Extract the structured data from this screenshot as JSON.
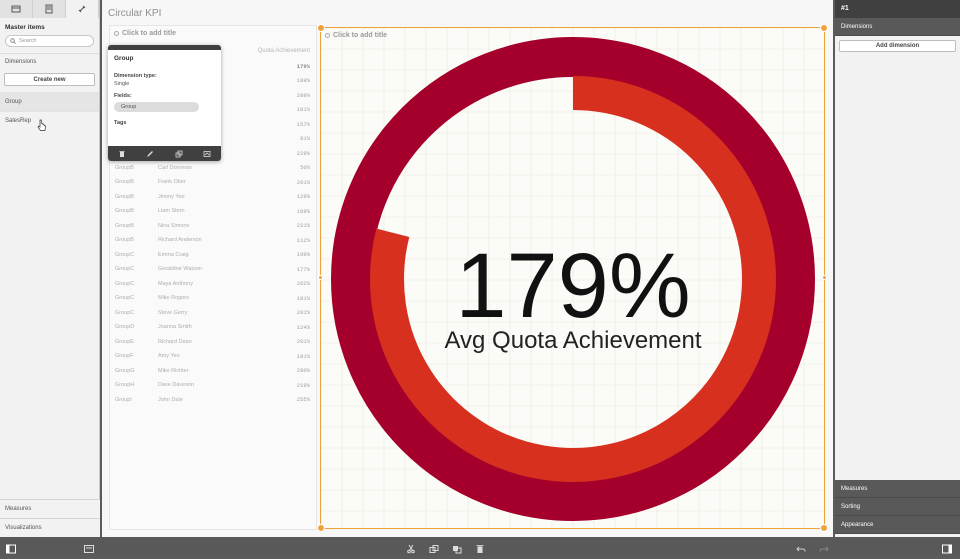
{
  "left_panel": {
    "title": "Master items",
    "search_placeholder": "Search",
    "dimensions_label": "Dimensions",
    "create_new_label": "Create new",
    "items": [
      {
        "label": "Group"
      },
      {
        "label": "SalesRep"
      }
    ],
    "measures_label": "Measures",
    "visualizations_label": "Visualizations"
  },
  "sheet": {
    "title": "Circular KPI"
  },
  "table": {
    "title": "Click to add title",
    "header_measure": "Quota Achievement",
    "total": "179%",
    "rows": [
      {
        "group": "",
        "rep": "",
        "value": "189%"
      },
      {
        "group": "",
        "rep": "",
        "value": "289%"
      },
      {
        "group": "",
        "rep": "",
        "value": "101%"
      },
      {
        "group": "",
        "rep": "",
        "value": "157%"
      },
      {
        "group": "",
        "rep": "",
        "value": "81%"
      },
      {
        "group": "",
        "rep": "",
        "value": "229%"
      },
      {
        "group": "GroupB",
        "rep": "Carl Donovan",
        "value": "50%"
      },
      {
        "group": "GroupB",
        "rep": "Frank Ober",
        "value": "261%"
      },
      {
        "group": "GroupB",
        "rep": "Jimmy Yeo",
        "value": "129%"
      },
      {
        "group": "GroupB",
        "rep": "Liam Stern",
        "value": "189%"
      },
      {
        "group": "GroupB",
        "rep": "Nina Simone",
        "value": "221%"
      },
      {
        "group": "GroupB",
        "rep": "Richard Anderson",
        "value": "112%"
      },
      {
        "group": "GroupC",
        "rep": "Emma Craig",
        "value": "199%"
      },
      {
        "group": "GroupC",
        "rep": "Geraldine Watson",
        "value": "177%"
      },
      {
        "group": "GroupC",
        "rep": "Maya Anthony",
        "value": "202%"
      },
      {
        "group": "GroupC",
        "rep": "Mike Rogers",
        "value": "181%"
      },
      {
        "group": "GroupC",
        "rep": "Steve Gerry",
        "value": "201%"
      },
      {
        "group": "GroupD",
        "rep": "Joanna Smith",
        "value": "124%"
      },
      {
        "group": "GroupE",
        "rep": "Richard Dean",
        "value": "201%"
      },
      {
        "group": "GroupF",
        "rep": "Amy Yeo",
        "value": "191%"
      },
      {
        "group": "GroupG",
        "rep": "Mike Richter",
        "value": "280%"
      },
      {
        "group": "GroupH",
        "rep": "Dave Daveson",
        "value": "219%"
      },
      {
        "group": "GroupI",
        "rep": "John Dale",
        "value": "255%"
      }
    ]
  },
  "popover": {
    "title": "Group",
    "dimension_type_label": "Dimension type:",
    "dimension_type_value": "Single",
    "fields_label": "Fields:",
    "field_chip": "Group",
    "tags_label": "Tags"
  },
  "kpi": {
    "title": "Click to add title",
    "value_text": "179%",
    "caption": "Avg Quota Achievement",
    "value_fraction": 1.79,
    "ring_color": "#a5002b",
    "overflow_color": "#d7301f"
  },
  "right_panel": {
    "header": "#1",
    "dimensions_label": "Dimensions",
    "add_dimension_label": "Add dimension",
    "measures_label": "Measures",
    "sorting_label": "Sorting",
    "appearance_label": "Appearance"
  },
  "colors": {
    "accent": "#f0a23a",
    "dark_bar": "#404040"
  }
}
